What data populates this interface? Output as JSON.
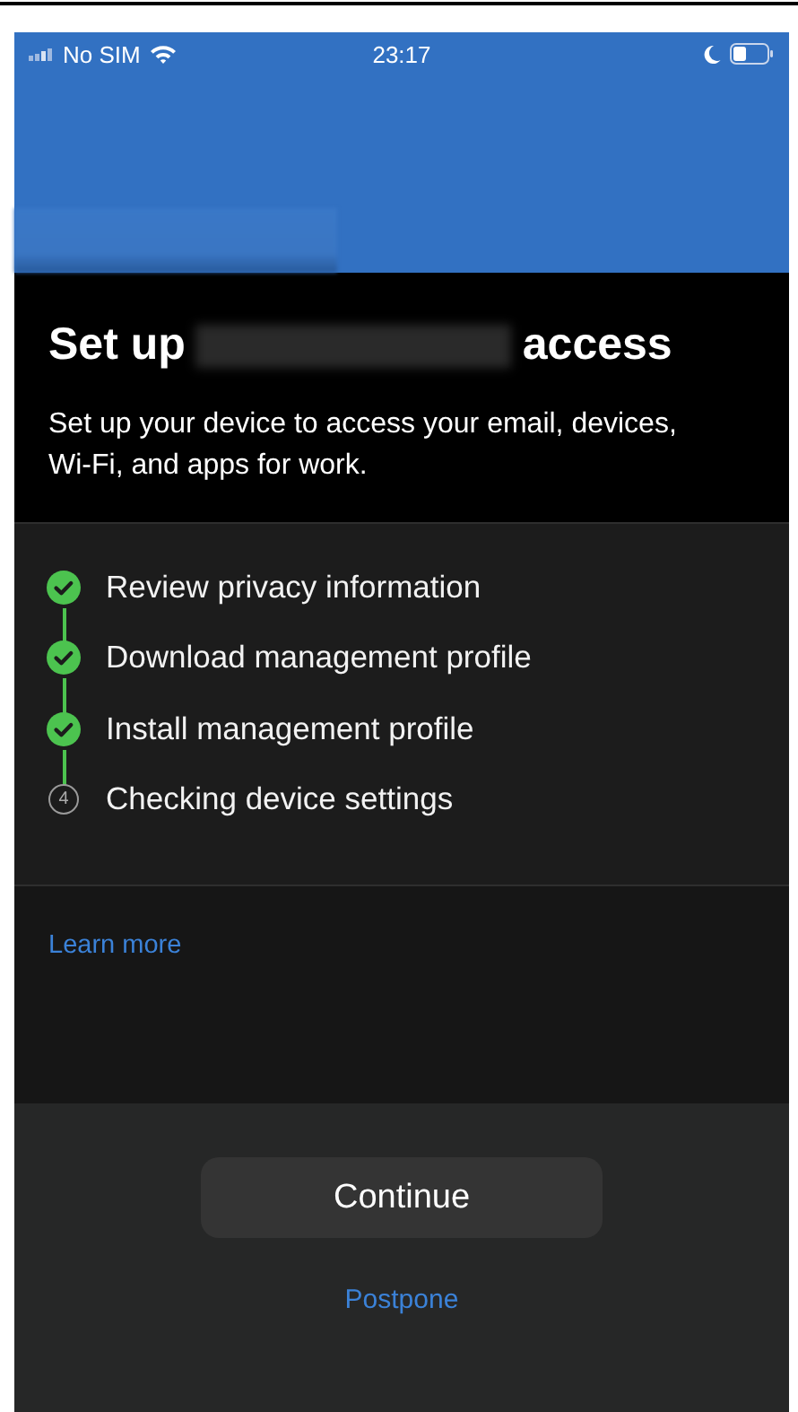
{
  "status_bar": {
    "carrier": "No SIM",
    "time": "23:17"
  },
  "heading": {
    "title_start": "Set up",
    "title_end": "access",
    "description": "Set up your device to access your email, devices, Wi-Fi, and apps for work."
  },
  "steps": [
    {
      "label": "Review privacy information",
      "done": true
    },
    {
      "label": "Download management profile",
      "done": true
    },
    {
      "label": "Install management profile",
      "done": true
    },
    {
      "label": "Checking device settings",
      "done": false,
      "number": "4"
    }
  ],
  "learn_more": "Learn more",
  "buttons": {
    "primary": "Continue",
    "secondary": "Postpone"
  }
}
